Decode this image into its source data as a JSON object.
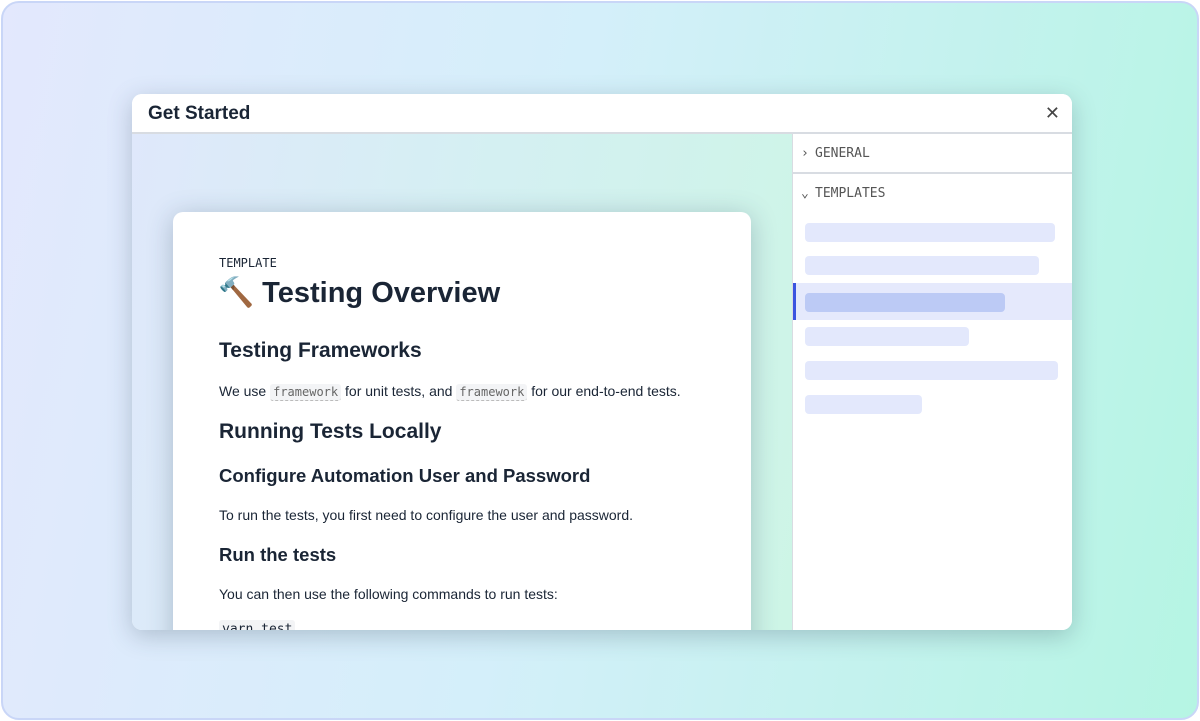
{
  "modal": {
    "title": "Get Started",
    "close_icon": "close-icon"
  },
  "document": {
    "eyebrow": "TEMPLATE",
    "emoji": "🔨",
    "title": "Testing Overview",
    "sections": {
      "frameworks_heading": "Testing Frameworks",
      "frameworks_text_1": "We use",
      "frameworks_code_1": "framework",
      "frameworks_text_2": "for unit tests, and",
      "frameworks_code_2": "framework",
      "frameworks_text_3": "for our end-to-end tests.",
      "running_heading": "Running Tests Locally",
      "configure_heading": "Configure Automation User and Password",
      "configure_text": "To run the tests, you first need to configure the user and password.",
      "run_heading": "Run the tests",
      "run_text": "You can then use the following commands to run tests:",
      "command": "yarn test"
    }
  },
  "sidebar": {
    "sections": [
      {
        "label": "GENERAL",
        "expanded": false
      },
      {
        "label": "TEMPLATES",
        "expanded": true
      }
    ],
    "template_items_count": 6,
    "selected_index": 2,
    "accent": "#3b54e0"
  }
}
